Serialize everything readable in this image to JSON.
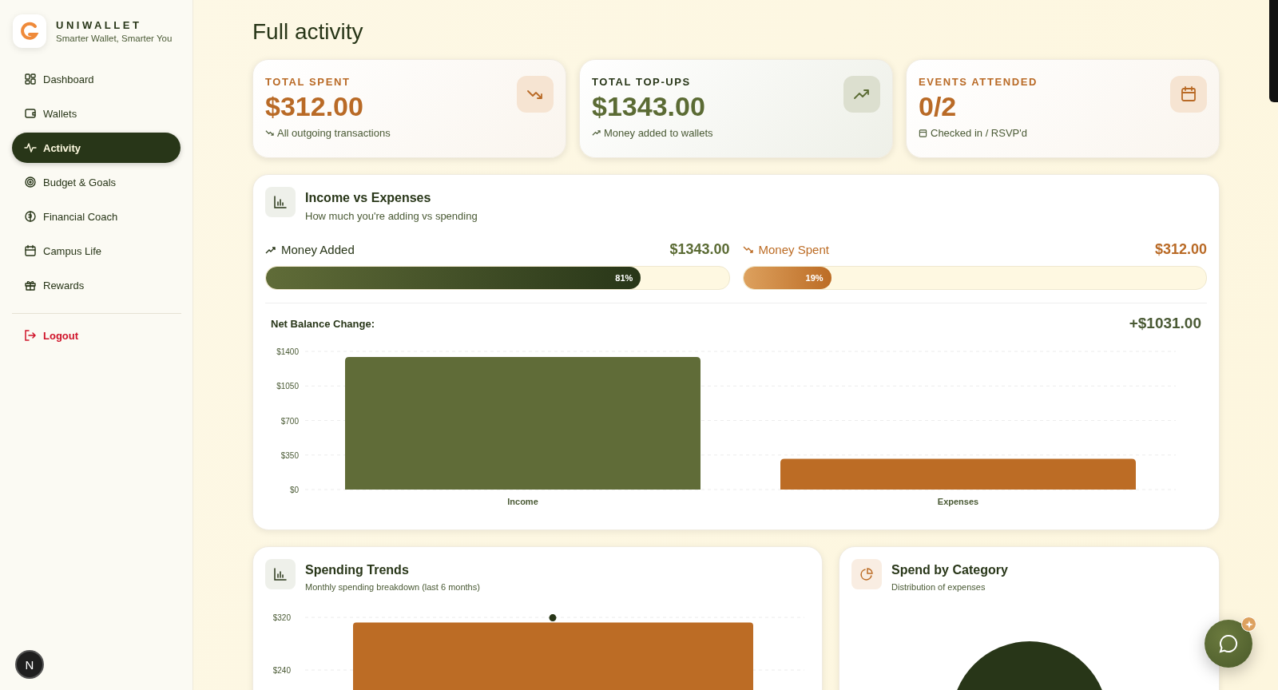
{
  "brand": {
    "name": "UNIWALLET",
    "tagline": "Smarter Wallet, Smarter You"
  },
  "nav": [
    {
      "label": "Dashboard",
      "selected": false
    },
    {
      "label": "Wallets",
      "selected": false
    },
    {
      "label": "Activity",
      "selected": true
    },
    {
      "label": "Budget & Goals",
      "selected": false
    },
    {
      "label": "Financial Coach",
      "selected": false
    },
    {
      "label": "Campus Life",
      "selected": false
    },
    {
      "label": "Rewards",
      "selected": false
    }
  ],
  "logout": "Logout",
  "avatar": "N",
  "page_title": "Full activity",
  "stats": [
    {
      "kind": "spent",
      "label": "TOTAL SPENT",
      "value": "$312.00",
      "note": "All outgoing transactions"
    },
    {
      "kind": "topup",
      "label": "TOTAL TOP-UPS",
      "value": "$1343.00",
      "note": "Money added to wallets"
    },
    {
      "kind": "events",
      "label": "EVENTS ATTENDED",
      "value": "0/2",
      "note": "Checked in / RSVP'd"
    }
  ],
  "income_vs_expenses": {
    "title": "Income vs Expenses",
    "subtitle": "How much you're adding vs spending",
    "meters": [
      {
        "kind": "added",
        "label": "Money Added",
        "amount": "$1343.00",
        "level": 0.81,
        "percent": "81%"
      },
      {
        "kind": "spent",
        "label": "Money Spent",
        "amount": "$312.00",
        "level": 0.19,
        "percent": "19%"
      }
    ],
    "net_label": "Net Balance Change:",
    "net_value": "+$1031.00",
    "chart_data": {
      "type": "bar",
      "categories": [
        "Income",
        "Expenses"
      ],
      "values": [
        1343,
        312
      ],
      "grid": true,
      "ylim": [
        0,
        1400
      ],
      "yticks": [
        {
          "value": 0,
          "label": "$0"
        },
        {
          "value": 350,
          "label": "$350"
        },
        {
          "value": 700,
          "label": "$700"
        },
        {
          "value": 1050,
          "label": "$1050"
        },
        {
          "value": 1400,
          "label": "$1400"
        }
      ]
    }
  },
  "spending_trends": {
    "title": "Spending Trends",
    "subtitle": "Monthly spending breakdown (last 6 months)",
    "chart_data": {
      "type": "bar",
      "values": [
        312
      ],
      "grid": true,
      "ylim": [
        0,
        320
      ],
      "yticks": [
        {
          "value": 240,
          "label": "$240"
        },
        {
          "value": 320,
          "label": "$320"
        }
      ]
    }
  },
  "spend_by_category": {
    "title": "Spend by Category",
    "subtitle": "Distribution of expenses"
  }
}
